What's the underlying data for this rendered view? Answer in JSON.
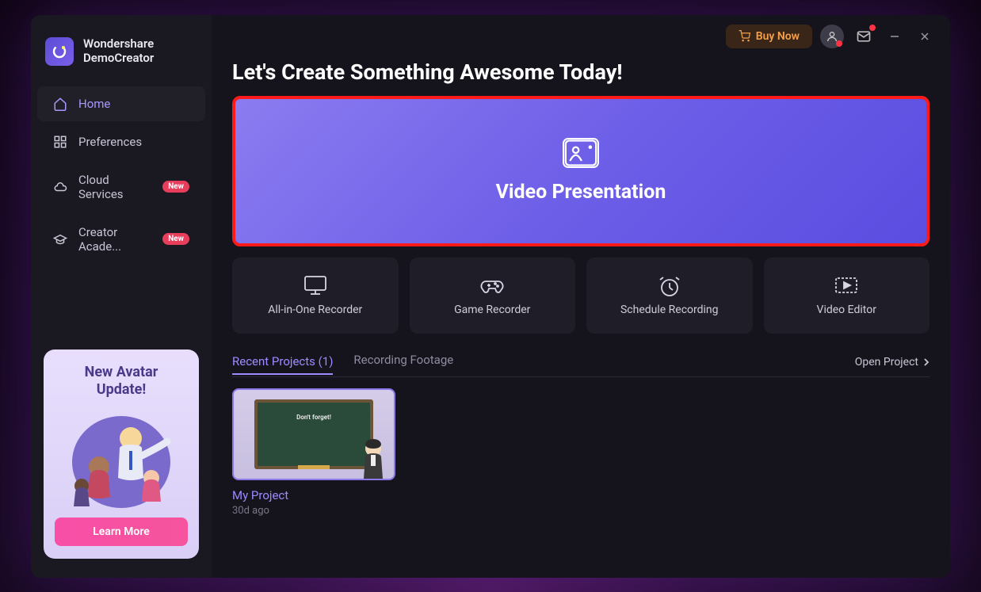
{
  "app": {
    "brand_line1": "Wondershare",
    "brand_line2": "DemoCreator"
  },
  "topbar": {
    "buy_label": "Buy Now"
  },
  "sidebar": {
    "items": [
      {
        "label": "Home"
      },
      {
        "label": "Preferences"
      },
      {
        "label": "Cloud Services",
        "badge": "New"
      },
      {
        "label": "Creator Acade...",
        "badge": "New"
      }
    ]
  },
  "promo": {
    "title_line1": "New Avatar",
    "title_line2": "Update!",
    "cta": "Learn More"
  },
  "main": {
    "headline": "Let's Create Something Awesome Today!",
    "hero_label": "Video Presentation",
    "cards": [
      {
        "label": "All-in-One Recorder"
      },
      {
        "label": "Game Recorder"
      },
      {
        "label": "Schedule Recording"
      },
      {
        "label": "Video Editor"
      }
    ],
    "tabs": {
      "recent_label": "Recent Projects (1)",
      "footage_label": "Recording Footage"
    },
    "open_project_label": "Open Project",
    "projects": [
      {
        "name": "My Project",
        "date": "30d ago",
        "thumb_text": "Don't forget!"
      }
    ]
  }
}
